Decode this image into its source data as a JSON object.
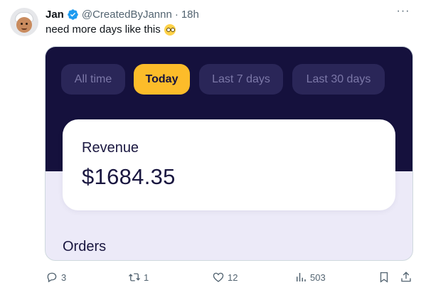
{
  "tweet": {
    "author_name": "Jan",
    "handle": "@CreatedByJannn",
    "separator": "·",
    "time": "18h",
    "text": "need more days like this",
    "more_label": "···"
  },
  "media": {
    "tabs": [
      {
        "label": "All time",
        "active": false
      },
      {
        "label": "Today",
        "active": true
      },
      {
        "label": "Last 7 days",
        "active": false
      },
      {
        "label": "Last 30 days",
        "active": false
      }
    ],
    "revenue_label": "Revenue",
    "revenue_value": "$1684.35",
    "orders_label": "Orders",
    "colors": {
      "dark_bg": "#15113d",
      "accent": "#fcbc2a",
      "light_bg": "#eceaf8"
    }
  },
  "actions": {
    "replies": "3",
    "retweets": "1",
    "likes": "12",
    "views": "503"
  },
  "icons": [
    "avatar",
    "verified-badge-icon",
    "more-icon",
    "emoji-icon",
    "reply-icon",
    "retweet-icon",
    "like-icon",
    "views-icon",
    "bookmark-icon",
    "share-icon"
  ]
}
